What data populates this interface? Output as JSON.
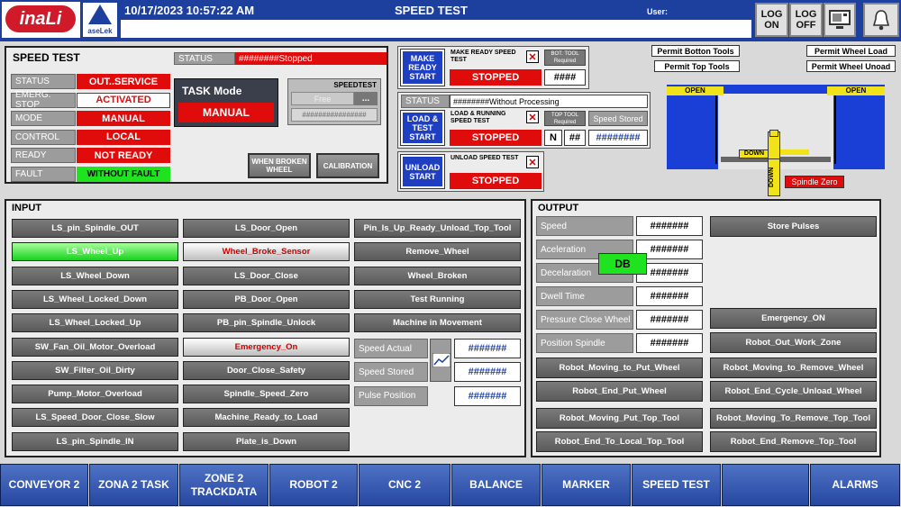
{
  "header": {
    "logo_text": "inaLi",
    "badge_text": "aseLek",
    "datetime": "10/17/2023 10:57:22 AM",
    "screen_title": "SPEED TEST",
    "user_label": "User:",
    "login_label": "LOG ON",
    "logout_label": "LOG OFF",
    "monitor_icon": "monitor-icon",
    "bell_icon": "bell-icon"
  },
  "speed_panel": {
    "title": "SPEED TEST",
    "status_label": "STATUS",
    "status_value": "########Stopped",
    "rows": [
      {
        "label": "STATUS",
        "value": "OUT..SERVICE",
        "style": "red"
      },
      {
        "label": "EMERG. STOP",
        "value": "ACTIVATED",
        "style": "white"
      },
      {
        "label": "MODE",
        "value": "MANUAL",
        "style": "red"
      },
      {
        "label": "CONTROL",
        "value": "LOCAL",
        "style": "red"
      },
      {
        "label": "READY",
        "value": "NOT READY",
        "style": "red"
      },
      {
        "label": "FAULT",
        "value": "WITHOUT FAULT",
        "style": "green"
      }
    ],
    "task_mode_label": "TASK Mode",
    "task_mode_value": "MANUAL",
    "speedtest_label": "SPEEDTEST",
    "speedtest_value": "Free",
    "speedtest_dots": "...",
    "speedtest_hash": "################",
    "when_broken_label": "WHEN BROKEN WHEEL",
    "calibration_label": "CALIBRATION"
  },
  "process": {
    "make_ready_btn": "MAKE READY START",
    "make_ready_title": "MAKE READY SPEED TEST",
    "make_ready_state": "STOPPED",
    "bot_tool_label": "BOT. TOOL Required",
    "bot_tool_value": "####",
    "status_label": "STATUS",
    "status_value": "########Without Processing",
    "load_btn": "LOAD & TEST START",
    "load_title": "LOAD & RUNNING SPEED TEST",
    "load_state": "STOPPED",
    "top_tool_label": "TOP TOOL Required",
    "speed_stored_label": "Speed Stored",
    "n_value": "N",
    "nn_value": "##",
    "speed_stored_value": "########",
    "unload_btn": "UNLOAD START",
    "unload_title": "UNLOAD SPEED TEST",
    "unload_state": "STOPPED",
    "x_mark": "✕"
  },
  "machine": {
    "permit_bottom_tools": "Permit Botton Tools",
    "permit_top_tools": "Permit Top Tools",
    "permit_wheel_load": "Permit Wheel Load",
    "permit_wheel_unload": "Permit Wheel Unoad",
    "open_left": "OPEN",
    "open_right": "OPEN",
    "down_h": "DOWN",
    "down_v": "DOWN",
    "spindle_zero": "Spindle Zero"
  },
  "input": {
    "title": "INPUT",
    "col1": [
      {
        "label": "LS_pin_Spindle_OUT",
        "style": "normal"
      },
      {
        "label": "LS_Wheel_Up",
        "style": "green"
      },
      {
        "label": "LS_Wheel_Down",
        "style": "normal"
      },
      {
        "label": "LS_Wheel_Locked_Down",
        "style": "normal"
      },
      {
        "label": "LS_Wheel_Locked_Up",
        "style": "normal"
      },
      {
        "label": "SW_Fan_Oil_Motor_Overload",
        "style": "normal"
      },
      {
        "label": "SW_Filter_Oil_Dirty",
        "style": "normal"
      },
      {
        "label": "Pump_Motor_Overload",
        "style": "normal"
      },
      {
        "label": "LS_Speed_Door_Close_Slow",
        "style": "normal"
      },
      {
        "label": "LS_pin_Spindle_IN",
        "style": "normal"
      }
    ],
    "col2": [
      {
        "label": "LS_Door_Open",
        "style": "normal"
      },
      {
        "label": "Wheel_Broke_Sensor",
        "style": "white"
      },
      {
        "label": "LS_Door_Close",
        "style": "normal"
      },
      {
        "label": "PB_Door_Open",
        "style": "normal"
      },
      {
        "label": "PB_pin_Spindle_Unlock",
        "style": "normal"
      },
      {
        "label": "Emergency_On",
        "style": "white"
      },
      {
        "label": "Door_Close_Safety",
        "style": "normal"
      },
      {
        "label": "Spindle_Speed_Zero",
        "style": "normal"
      },
      {
        "label": "Machine_Ready_to_Load",
        "style": "normal"
      },
      {
        "label": "Plate_is_Down",
        "style": "normal"
      }
    ],
    "col3": [
      {
        "label": "Pin_Is_Up_Ready_Unload_Top_Tool"
      },
      {
        "label": "Remove_Wheel"
      },
      {
        "label": "Wheel_Broken"
      },
      {
        "label": "Test Running"
      },
      {
        "label": "Machine in Movement"
      }
    ],
    "readouts": [
      {
        "label": "Speed Actual",
        "value": "#######"
      },
      {
        "label": "Speed Stored",
        "value": "#######"
      },
      {
        "label": "Pulse Position",
        "value": "#######"
      }
    ],
    "chart_icon": "chart-icon"
  },
  "output": {
    "title": "OUTPUT",
    "readouts": [
      {
        "label": "Speed",
        "value": "#######"
      },
      {
        "label": "Aceleration",
        "value": "#######"
      },
      {
        "label": "Decelaration",
        "value": "#######"
      },
      {
        "label": "Dwell Time",
        "value": "#######"
      },
      {
        "label": "Pressure Close Wheel",
        "value": "#######"
      },
      {
        "label": "Position Spindle",
        "value": "#######"
      }
    ],
    "db_label": "DB",
    "store_pulses": "Store Pulses",
    "left_buttons": [
      "Robot_Moving_to_Put_Wheel",
      "Robot_End_Put_Wheel",
      "Robot_Moving_Put_Top_Tool",
      "Robot_End_To_Local_Top_Tool"
    ],
    "right_buttons": [
      "Emergency_ON",
      "Robot_Out_Work_Zone",
      "Robot_Moving_to_Remove_Wheel",
      "Robot_End_Cycle_Unload_Wheel",
      "Robot_Moving_To_Remove_Top_Tool",
      "Robot_End_Remove_Top_Tool"
    ]
  },
  "footer": {
    "nav": [
      "CONVEYOR 2",
      "ZONA 2 TASK",
      "ZONE 2 TRACKDATA",
      "ROBOT 2",
      "CNC 2",
      "BALANCE",
      "MARKER",
      "SPEED TEST",
      "",
      "ALARMS"
    ]
  }
}
